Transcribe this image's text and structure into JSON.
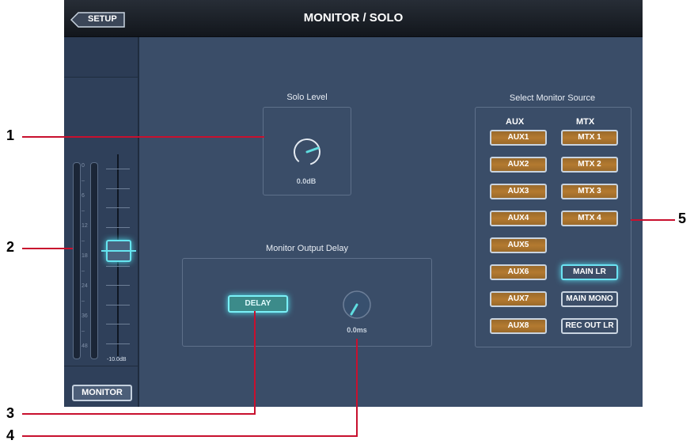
{
  "header": {
    "title": "MONITOR / SOLO",
    "back_label": "SETUP"
  },
  "left_strip": {
    "meter_ticks": [
      "0",
      "–",
      "6",
      "–",
      "12",
      "–",
      "18",
      "–",
      "24",
      "–",
      "36",
      "–",
      "48"
    ],
    "fader_value": "-10.0dB",
    "monitor_button": "MONITOR"
  },
  "solo": {
    "label": "Solo Level",
    "value": "0.0dB"
  },
  "delay": {
    "label": "Monitor Output Delay",
    "button": "DELAY",
    "value": "0.0ms"
  },
  "sources": {
    "label": "Select Monitor Source",
    "aux_header": "AUX",
    "mtx_header": "MTX",
    "aux": [
      "AUX1",
      "AUX2",
      "AUX3",
      "AUX4",
      "AUX5",
      "AUX6",
      "AUX7",
      "AUX8"
    ],
    "mtx": [
      "MTX 1",
      "MTX 2",
      "MTX 3",
      "MTX 4"
    ],
    "main_lr": "MAIN LR",
    "main_mono": "MAIN MONO",
    "rec_out_lr": "REC OUT LR"
  },
  "callouts": [
    "1",
    "2",
    "3",
    "4",
    "5"
  ],
  "colors": {
    "accent_cyan": "#66e5f0",
    "aux_orange": "#b47a30",
    "callout_red": "#c8102e",
    "panel": "#3a4d68"
  }
}
